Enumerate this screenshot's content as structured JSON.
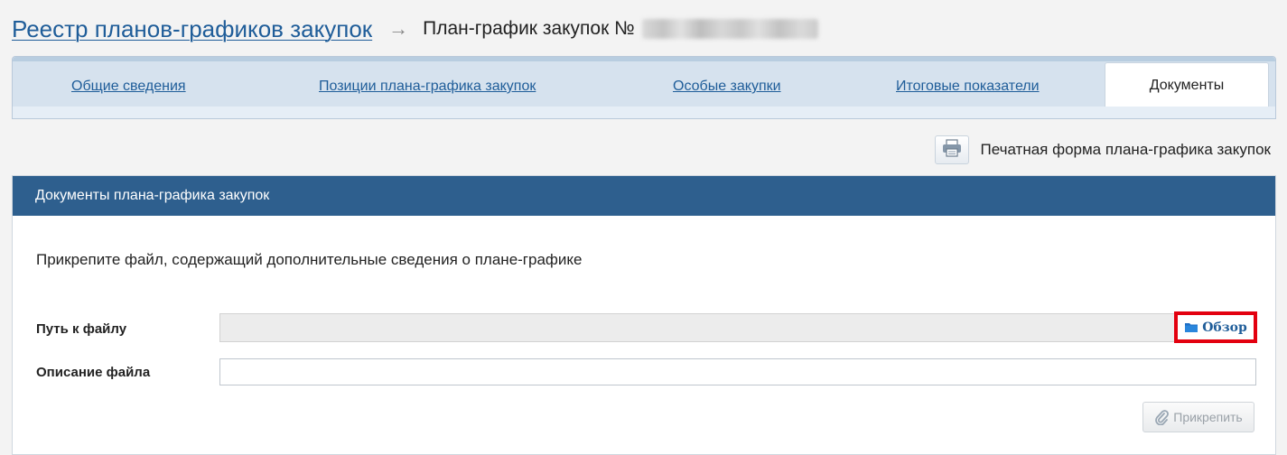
{
  "breadcrumb": {
    "link": "Реестр планов-графиков закупок",
    "arrow": "→",
    "current": "План-график закупок №"
  },
  "tabs": [
    {
      "label": "Общие сведения",
      "active": false
    },
    {
      "label": "Позиции плана-графика закупок",
      "active": false
    },
    {
      "label": "Особые закупки",
      "active": false
    },
    {
      "label": "Итоговые показатели",
      "active": false
    },
    {
      "label": "Документы",
      "active": true
    }
  ],
  "print": {
    "icon": "printer-icon",
    "label": "Печатная форма плана-графика закупок"
  },
  "panel": {
    "title": "Документы плана-графика закупок",
    "hint": "Прикрепите файл, содержащий дополнительные сведения о плане-графике",
    "file_path_label": "Путь к файлу",
    "file_path_value": "",
    "browse_label": "Обзор",
    "browse_icon": "folder-icon",
    "description_label": "Описание файла",
    "description_value": "",
    "attach_label": "Прикрепить",
    "attach_icon": "paperclip-icon"
  },
  "colors": {
    "link": "#1f5d99",
    "header": "#2e5f8e",
    "highlight": "#e3000f"
  }
}
